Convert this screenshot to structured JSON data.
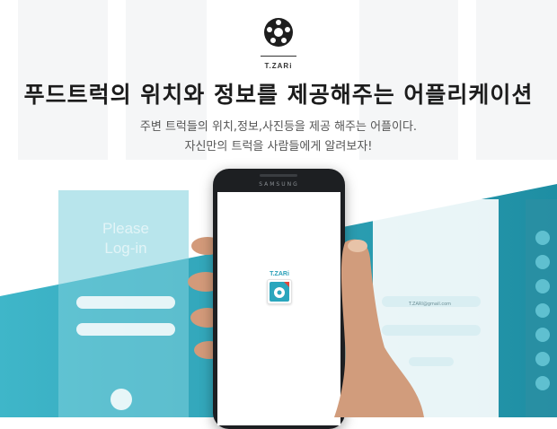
{
  "brand": {
    "name": "T.ZARi",
    "accent": "#2aa6bd"
  },
  "headline": "푸드트럭의 위치와 정보를 제공해주는 어플리케이션",
  "subtitle_line1": "주변 트럭들의 위치,정보,사진등을 제공 해주는 어플이다.",
  "subtitle_line2": "자신만의 트럭을 사람들에게 알려보자!",
  "phone": {
    "brand_label": "SAMSUNG",
    "app_label": "T.ZARi"
  },
  "background_screens": {
    "login_title": "Please Log-in",
    "email_sample": "T.ZARI@gmail.com"
  }
}
